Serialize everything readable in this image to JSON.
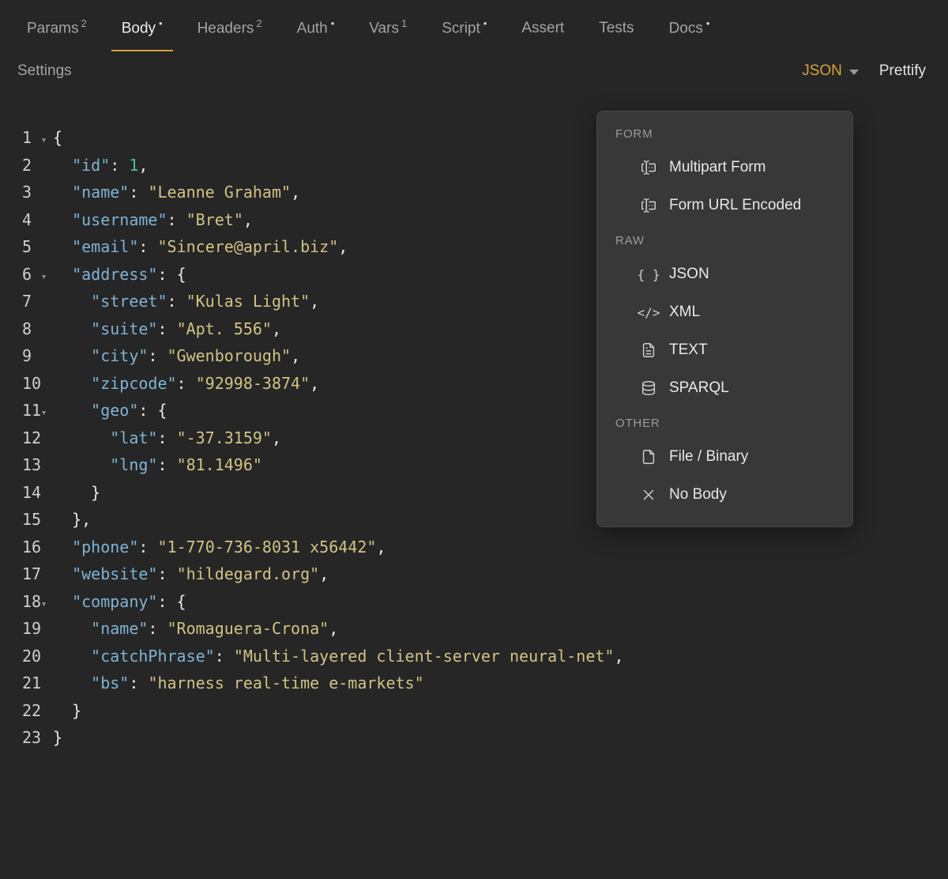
{
  "colors": {
    "background": "#262626",
    "accent": "#d7a43d",
    "key": "#7fb3d5",
    "string": "#d1c385",
    "number": "#46c29e",
    "punctuation": "#e8e8e8",
    "menu_background": "#383838"
  },
  "tabs": [
    {
      "label": "Params",
      "sup": "2",
      "dot": false,
      "active": false
    },
    {
      "label": "Body",
      "sup": "",
      "dot": true,
      "active": true
    },
    {
      "label": "Headers",
      "sup": "2",
      "dot": false,
      "active": false
    },
    {
      "label": "Auth",
      "sup": "",
      "dot": true,
      "active": false
    },
    {
      "label": "Vars",
      "sup": "1",
      "dot": false,
      "active": false
    },
    {
      "label": "Script",
      "sup": "",
      "dot": true,
      "active": false
    },
    {
      "label": "Assert",
      "sup": "",
      "dot": false,
      "active": false
    },
    {
      "label": "Tests",
      "sup": "",
      "dot": false,
      "active": false
    },
    {
      "label": "Docs",
      "sup": "",
      "dot": true,
      "active": false
    }
  ],
  "toolbar": {
    "settings_label": "Settings",
    "mode_label": "JSON",
    "prettify_label": "Prettify"
  },
  "body_type_menu": {
    "sections": [
      {
        "header": "FORM",
        "items": [
          {
            "icon": "multipart-form-icon",
            "label": "Multipart Form"
          },
          {
            "icon": "form-url-encoded-icon",
            "label": "Form URL Encoded"
          }
        ]
      },
      {
        "header": "RAW",
        "items": [
          {
            "icon": "json-braces-icon",
            "label": "JSON"
          },
          {
            "icon": "xml-tags-icon",
            "label": "XML"
          },
          {
            "icon": "text-file-icon",
            "label": "TEXT"
          },
          {
            "icon": "database-icon",
            "label": "SPARQL"
          }
        ]
      },
      {
        "header": "OTHER",
        "items": [
          {
            "icon": "file-icon",
            "label": "File / Binary"
          },
          {
            "icon": "x-icon",
            "label": "No Body"
          }
        ]
      }
    ]
  },
  "editor": {
    "lines": [
      {
        "n": 1,
        "fold": true,
        "t": [
          [
            "p",
            "{"
          ]
        ]
      },
      {
        "n": 2,
        "fold": false,
        "t": [
          [
            "p",
            "  "
          ],
          [
            "k",
            "\"id\""
          ],
          [
            "p",
            ": "
          ],
          [
            "n",
            "1"
          ],
          [
            "p",
            ","
          ]
        ]
      },
      {
        "n": 3,
        "fold": false,
        "t": [
          [
            "p",
            "  "
          ],
          [
            "k",
            "\"name\""
          ],
          [
            "p",
            ": "
          ],
          [
            "s",
            "\"Leanne Graham\""
          ],
          [
            "p",
            ","
          ]
        ]
      },
      {
        "n": 4,
        "fold": false,
        "t": [
          [
            "p",
            "  "
          ],
          [
            "k",
            "\"username\""
          ],
          [
            "p",
            ": "
          ],
          [
            "s",
            "\"Bret\""
          ],
          [
            "p",
            ","
          ]
        ]
      },
      {
        "n": 5,
        "fold": false,
        "t": [
          [
            "p",
            "  "
          ],
          [
            "k",
            "\"email\""
          ],
          [
            "p",
            ": "
          ],
          [
            "s",
            "\"Sincere@april.biz\""
          ],
          [
            "p",
            ","
          ]
        ]
      },
      {
        "n": 6,
        "fold": true,
        "t": [
          [
            "p",
            "  "
          ],
          [
            "k",
            "\"address\""
          ],
          [
            "p",
            ": {"
          ]
        ]
      },
      {
        "n": 7,
        "fold": false,
        "t": [
          [
            "p",
            "    "
          ],
          [
            "k",
            "\"street\""
          ],
          [
            "p",
            ": "
          ],
          [
            "s",
            "\"Kulas Light\""
          ],
          [
            "p",
            ","
          ]
        ]
      },
      {
        "n": 8,
        "fold": false,
        "t": [
          [
            "p",
            "    "
          ],
          [
            "k",
            "\"suite\""
          ],
          [
            "p",
            ": "
          ],
          [
            "s",
            "\"Apt. 556\""
          ],
          [
            "p",
            ","
          ]
        ]
      },
      {
        "n": 9,
        "fold": false,
        "t": [
          [
            "p",
            "    "
          ],
          [
            "k",
            "\"city\""
          ],
          [
            "p",
            ": "
          ],
          [
            "s",
            "\"Gwenborough\""
          ],
          [
            "p",
            ","
          ]
        ]
      },
      {
        "n": 10,
        "fold": false,
        "t": [
          [
            "p",
            "    "
          ],
          [
            "k",
            "\"zipcode\""
          ],
          [
            "p",
            ": "
          ],
          [
            "s",
            "\"92998-3874\""
          ],
          [
            "p",
            ","
          ]
        ]
      },
      {
        "n": 11,
        "fold": true,
        "t": [
          [
            "p",
            "    "
          ],
          [
            "k",
            "\"geo\""
          ],
          [
            "p",
            ": {"
          ]
        ]
      },
      {
        "n": 12,
        "fold": false,
        "t": [
          [
            "p",
            "      "
          ],
          [
            "k",
            "\"lat\""
          ],
          [
            "p",
            ": "
          ],
          [
            "s",
            "\"-37.3159\""
          ],
          [
            "p",
            ","
          ]
        ]
      },
      {
        "n": 13,
        "fold": false,
        "t": [
          [
            "p",
            "      "
          ],
          [
            "k",
            "\"lng\""
          ],
          [
            "p",
            ": "
          ],
          [
            "s",
            "\"81.1496\""
          ]
        ]
      },
      {
        "n": 14,
        "fold": false,
        "t": [
          [
            "p",
            "    }"
          ]
        ]
      },
      {
        "n": 15,
        "fold": false,
        "t": [
          [
            "p",
            "  },"
          ]
        ]
      },
      {
        "n": 16,
        "fold": false,
        "t": [
          [
            "p",
            "  "
          ],
          [
            "k",
            "\"phone\""
          ],
          [
            "p",
            ": "
          ],
          [
            "s",
            "\"1-770-736-8031 x56442\""
          ],
          [
            "p",
            ","
          ]
        ]
      },
      {
        "n": 17,
        "fold": false,
        "t": [
          [
            "p",
            "  "
          ],
          [
            "k",
            "\"website\""
          ],
          [
            "p",
            ": "
          ],
          [
            "s",
            "\"hildegard.org\""
          ],
          [
            "p",
            ","
          ]
        ]
      },
      {
        "n": 18,
        "fold": true,
        "t": [
          [
            "p",
            "  "
          ],
          [
            "k",
            "\"company\""
          ],
          [
            "p",
            ": {"
          ]
        ]
      },
      {
        "n": 19,
        "fold": false,
        "t": [
          [
            "p",
            "    "
          ],
          [
            "k",
            "\"name\""
          ],
          [
            "p",
            ": "
          ],
          [
            "s",
            "\"Romaguera-Crona\""
          ],
          [
            "p",
            ","
          ]
        ]
      },
      {
        "n": 20,
        "fold": false,
        "t": [
          [
            "p",
            "    "
          ],
          [
            "k",
            "\"catchPhrase\""
          ],
          [
            "p",
            ": "
          ],
          [
            "s",
            "\"Multi-layered client-server neural-net\""
          ],
          [
            "p",
            ","
          ]
        ]
      },
      {
        "n": 21,
        "fold": false,
        "t": [
          [
            "p",
            "    "
          ],
          [
            "k",
            "\"bs\""
          ],
          [
            "p",
            ": "
          ],
          [
            "s",
            "\"harness real-time e-markets\""
          ]
        ]
      },
      {
        "n": 22,
        "fold": false,
        "t": [
          [
            "p",
            "  }"
          ]
        ]
      },
      {
        "n": 23,
        "fold": false,
        "t": [
          [
            "p",
            "}"
          ]
        ]
      }
    ]
  }
}
